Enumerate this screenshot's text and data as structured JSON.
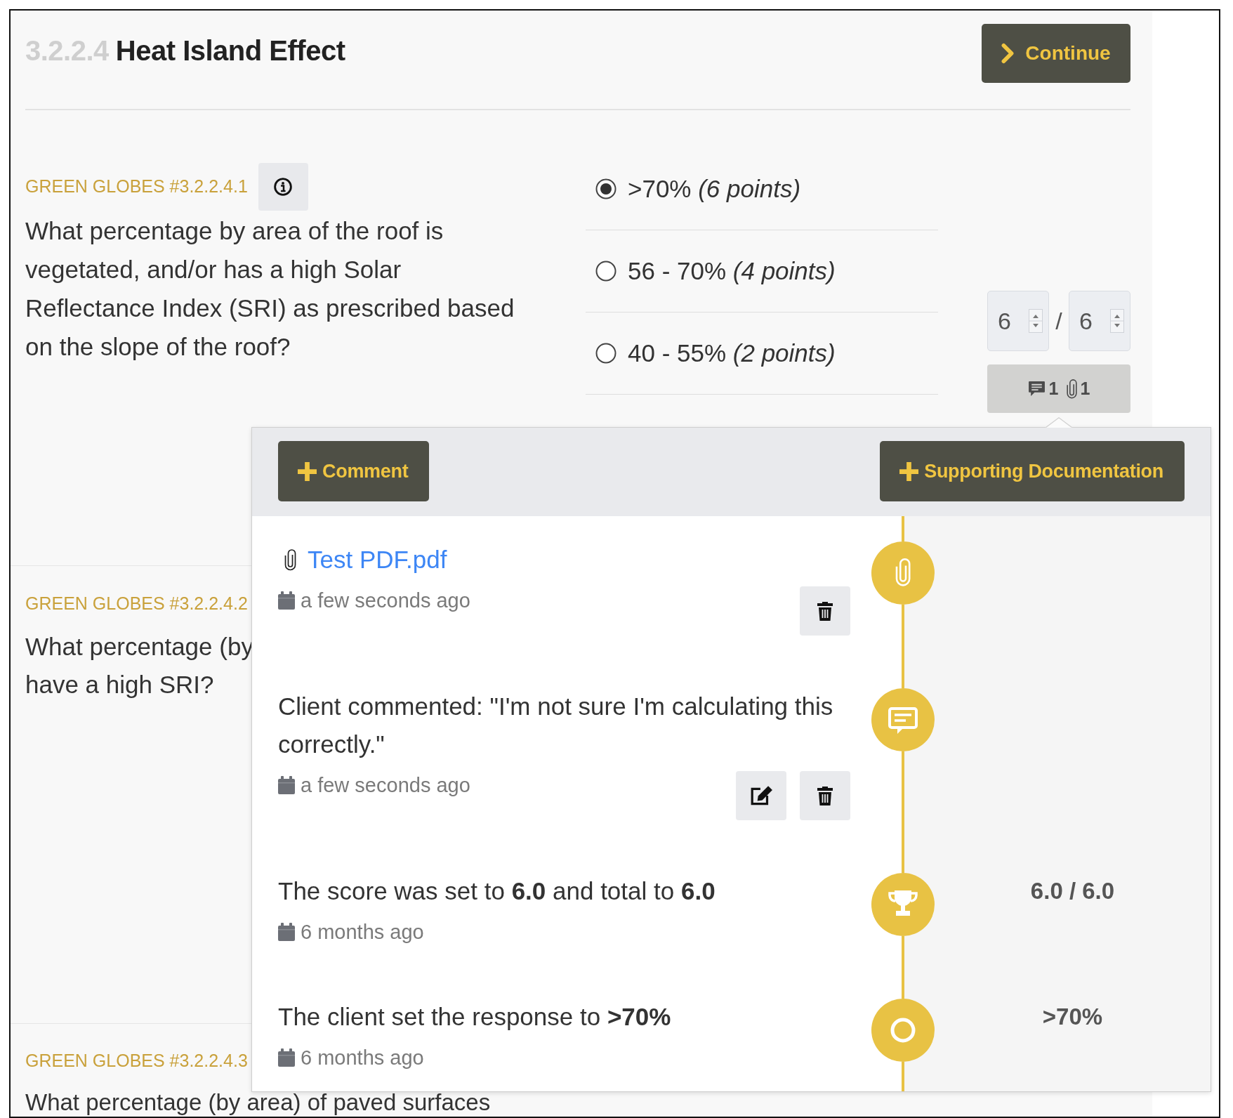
{
  "header": {
    "number": "3.2.2.4",
    "title": "Heat Island Effect",
    "continue_label": "Continue"
  },
  "questions": [
    {
      "code": "GREEN GLOBES #3.2.2.4.1",
      "info_button": true,
      "text": "What percentage by area of the roof is vegetated, and/or has a high Solar Reflectance Index (SRI) as prescribed based on the slope of the roof?",
      "options": [
        {
          "label": ">70% *(6 points)*",
          "selected": true
        },
        {
          "label": "56 - 70% *(4 points)*",
          "selected": false
        },
        {
          "label": "40 - 55% *(2 points)*",
          "selected": false
        }
      ],
      "score": {
        "value": "6",
        "separator": "/",
        "total": "6"
      },
      "activity": {
        "comments": "1",
        "attachments": "1"
      }
    },
    {
      "code": "GREEN GLOBES #3.2.2.4.2",
      "info_button": false,
      "lines": [
        "What percentage (by",
        "have a high SRI?"
      ]
    },
    {
      "code": "GREEN GLOBES #3.2.2.4.3",
      "info_button": false,
      "lines": [
        "What percentage (by area) of paved surfaces"
      ]
    }
  ],
  "popover": {
    "buttons": [
      {
        "label": "Comment"
      },
      {
        "label": "Supporting Documentation"
      }
    ],
    "entries": [
      {
        "kind": "attachment",
        "file": "Test PDF.pdf",
        "time": "a few seconds ago",
        "can_edit": false,
        "can_delete": true
      },
      {
        "kind": "comment",
        "text": "Client commented: \"I'm not sure I'm calculating this correctly.\"",
        "time": "a few seconds ago",
        "can_edit": true,
        "can_delete": true
      },
      {
        "kind": "score",
        "text": "The score was set to **6.0** and total to **6.0**",
        "time": "6 months ago",
        "value": "6.0 / 6.0",
        "can_edit": false,
        "can_delete": false
      },
      {
        "kind": "response",
        "text": "The client set the response to **>70%**",
        "time": "6 months ago",
        "value": ">70%",
        "can_edit": false,
        "can_delete": false
      }
    ]
  }
}
